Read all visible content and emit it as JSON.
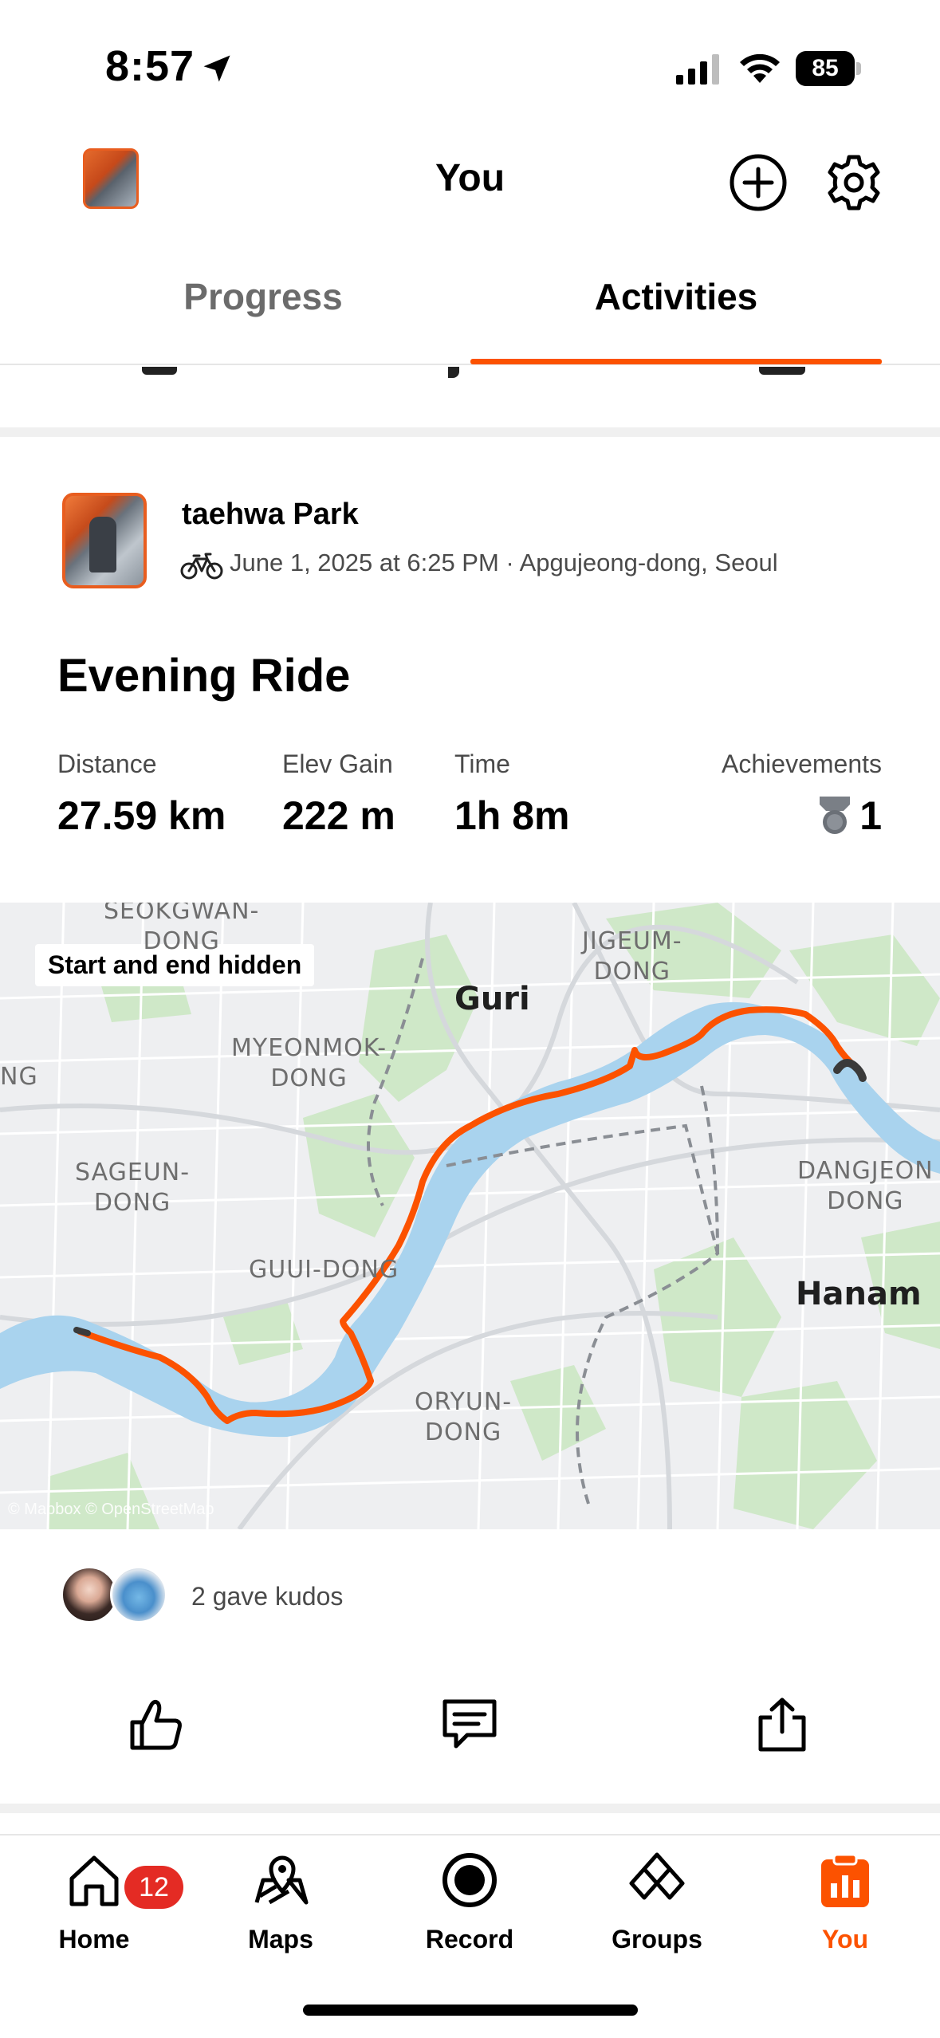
{
  "status_bar": {
    "time": "8:57",
    "battery": "85",
    "icons": [
      "location-arrow-icon",
      "cellular-signal-icon",
      "wifi-icon",
      "battery-icon"
    ]
  },
  "header": {
    "title": "You",
    "icons": [
      "profile-avatar",
      "add-circle-icon",
      "gear-icon"
    ]
  },
  "tabs": [
    {
      "label": "Progress",
      "active": false
    },
    {
      "label": "Activities",
      "active": true
    }
  ],
  "activity": {
    "athlete_name": "taehwa Park",
    "meta": "June 1, 2025 at 6:25 PM · Apgujeong-dong, Seoul",
    "type_icon": "bicycle-icon",
    "title": "Evening Ride",
    "stats": [
      {
        "label": "Distance",
        "value": "27.59 km"
      },
      {
        "label": "Elev Gain",
        "value": "222 m"
      },
      {
        "label": "Time",
        "value": "1h 8m"
      }
    ],
    "achievements": {
      "label": "Achievements",
      "value": "1",
      "icon": "trophy-icon"
    }
  },
  "map": {
    "badge": "Start and end hidden",
    "labels": [
      {
        "text": "SEOKGWAN-\nDONG",
        "kind": "district"
      },
      {
        "text": "JIGEUM-\nDONG",
        "kind": "district"
      },
      {
        "text": "Guri",
        "kind": "city"
      },
      {
        "text": "MYEONMOK-\nDONG",
        "kind": "district"
      },
      {
        "text": "NG",
        "kind": "district"
      },
      {
        "text": "SAGEUN-\nDONG",
        "kind": "district"
      },
      {
        "text": "DANGJEON\nDONG",
        "kind": "district"
      },
      {
        "text": "GUUI-DONG",
        "kind": "district"
      },
      {
        "text": "Hanam",
        "kind": "city"
      },
      {
        "text": "ORYUN-\nDONG",
        "kind": "district"
      }
    ],
    "attribution": "© Mapbox © OpenStreetMap",
    "route_color": "#fc5200",
    "river_color": "#a9d3ee",
    "park_color": "#c9e6c3"
  },
  "kudos": {
    "text": "2 gave kudos"
  },
  "actions": [
    {
      "name": "kudos-button",
      "icon": "thumbs-up-icon"
    },
    {
      "name": "comment-button",
      "icon": "comment-icon"
    },
    {
      "name": "share-button",
      "icon": "share-icon"
    }
  ],
  "bottom_nav": [
    {
      "label": "Home",
      "icon": "home-icon",
      "badge": "12",
      "active": false
    },
    {
      "label": "Maps",
      "icon": "map-pin-icon",
      "active": false
    },
    {
      "label": "Record",
      "icon": "record-icon",
      "active": false
    },
    {
      "label": "Groups",
      "icon": "groups-icon",
      "active": false
    },
    {
      "label": "You",
      "icon": "clipboard-chart-icon",
      "active": true
    }
  ],
  "colors": {
    "accent": "#fc5200",
    "badge_red": "#e42b24",
    "text_secondary": "#4a4a4a"
  }
}
